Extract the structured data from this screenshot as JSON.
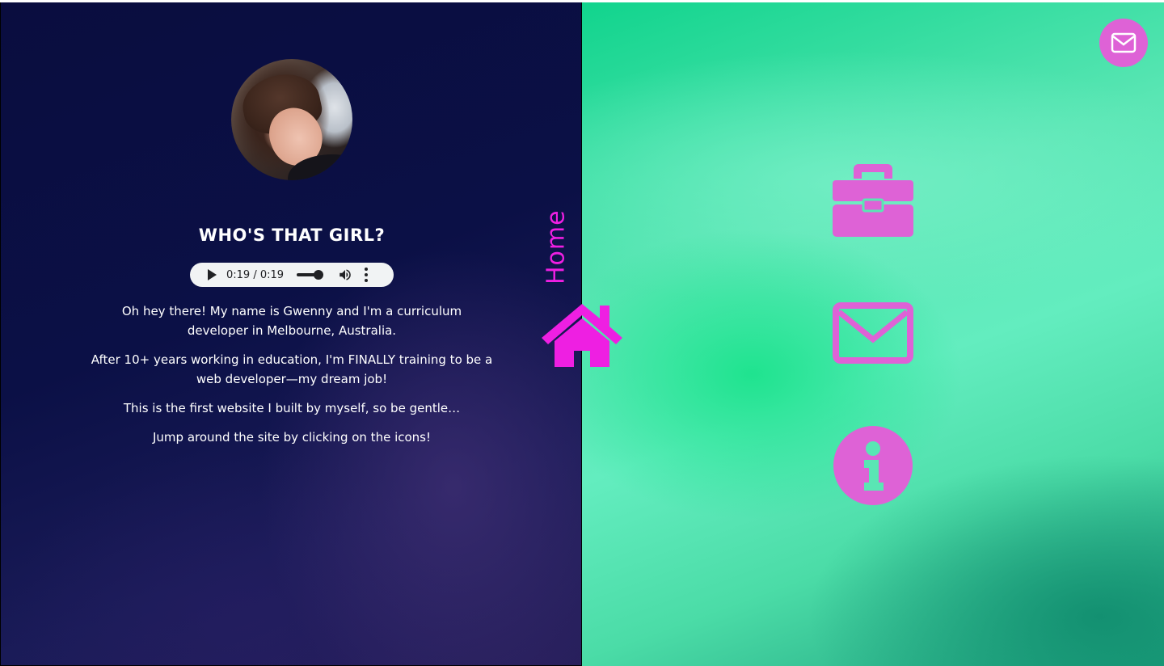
{
  "profile": {
    "heading": "WHO'S THAT GIRL?",
    "paragraphs": [
      "Oh hey there! My name is Gwenny and I'm a curriculum developer in Melbourne, Australia.",
      "After 10+ years working in education, I'm FINALLY training to be a web developer—my dream job!",
      "This is the first website I built by myself, so be gentle…",
      "Jump around the site by clicking on the icons!"
    ]
  },
  "audio_player": {
    "time": "0:19 / 0:19"
  },
  "nav": {
    "home_label": "Home",
    "icons": [
      "home-icon",
      "briefcase-icon",
      "mail-icon",
      "info-icon"
    ]
  },
  "colors": {
    "accent_pink": "#de62d6",
    "home_magenta": "#ee1fe2",
    "left_bg": "#0b1046",
    "right_bg": "#4fe3ae"
  }
}
